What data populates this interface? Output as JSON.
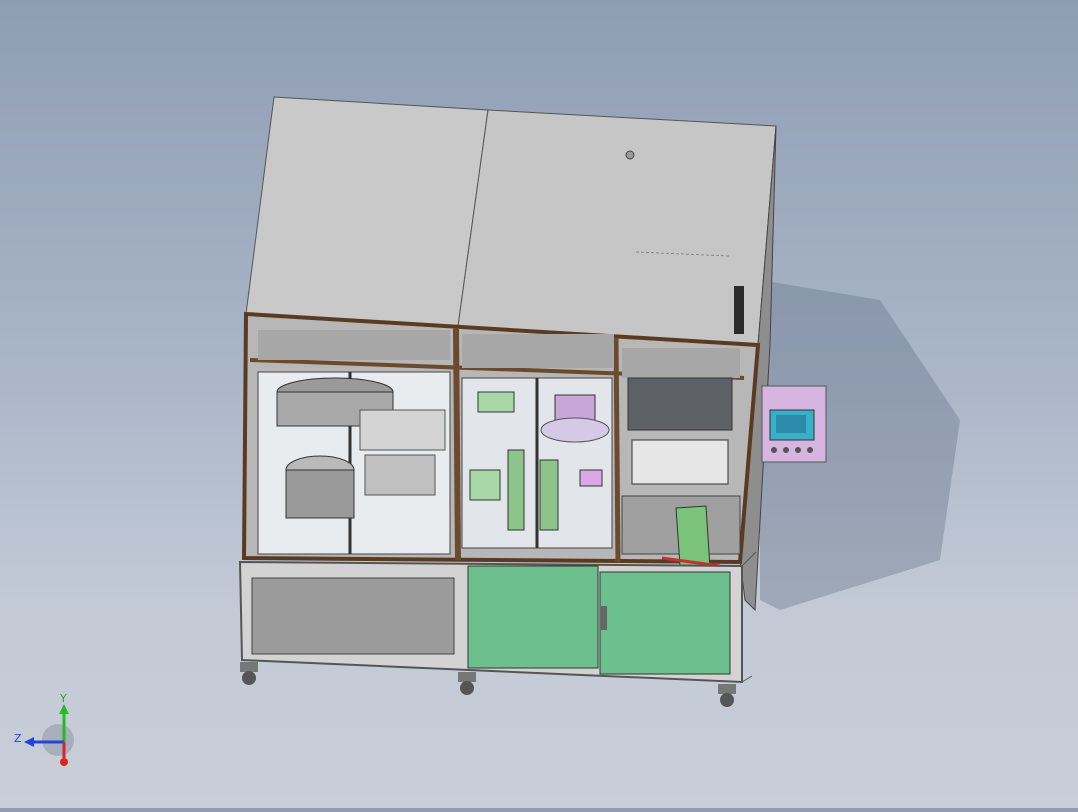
{
  "viewport": {
    "background_top": "#8f9db3",
    "background_bottom": "#c9ced8"
  },
  "model": {
    "panel_color": "#c8c8c8",
    "frame_color": "#6b4a2e",
    "door_color": "#6cc08e",
    "hmi_color": "#d6b6e0",
    "hmi_screen_color": "#3ab0c8"
  },
  "triad": {
    "y_label": "Y",
    "z_label": "Z",
    "y_color": "#22bb22",
    "z_color": "#2244dd",
    "x_color": "#dd2222"
  }
}
